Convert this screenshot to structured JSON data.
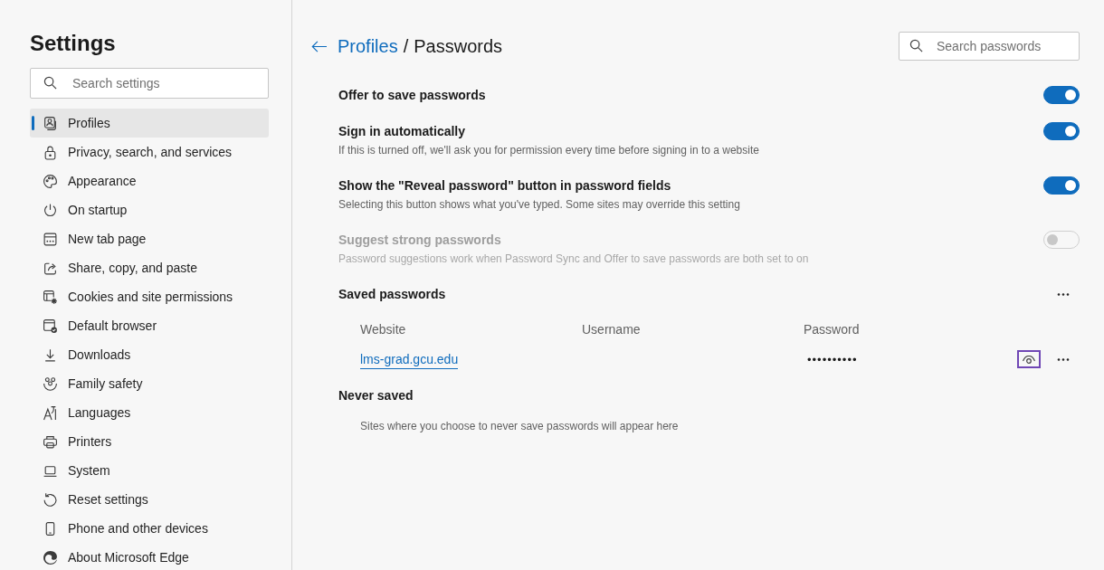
{
  "sidebar": {
    "title": "Settings",
    "search": {
      "placeholder": "Search settings"
    },
    "items": [
      {
        "label": "Profiles",
        "kind": "profiles",
        "selected": true
      },
      {
        "label": "Privacy, search, and services",
        "kind": "privacy",
        "selected": false
      },
      {
        "label": "Appearance",
        "kind": "appearance",
        "selected": false
      },
      {
        "label": "On startup",
        "kind": "startup",
        "selected": false
      },
      {
        "label": "New tab page",
        "kind": "newtab",
        "selected": false
      },
      {
        "label": "Share, copy, and paste",
        "kind": "share",
        "selected": false
      },
      {
        "label": "Cookies and site permissions",
        "kind": "cookies",
        "selected": false
      },
      {
        "label": "Default browser",
        "kind": "default",
        "selected": false
      },
      {
        "label": "Downloads",
        "kind": "downloads",
        "selected": false
      },
      {
        "label": "Family safety",
        "kind": "family",
        "selected": false
      },
      {
        "label": "Languages",
        "kind": "languages",
        "selected": false
      },
      {
        "label": "Printers",
        "kind": "printers",
        "selected": false
      },
      {
        "label": "System",
        "kind": "system",
        "selected": false
      },
      {
        "label": "Reset settings",
        "kind": "reset",
        "selected": false
      },
      {
        "label": "Phone and other devices",
        "kind": "phone",
        "selected": false
      },
      {
        "label": "About Microsoft Edge",
        "kind": "about",
        "selected": false
      }
    ]
  },
  "header": {
    "breadcrumb": [
      {
        "label": "Profiles",
        "kind": "link"
      },
      {
        "label": "/",
        "kind": "separator"
      },
      {
        "label": "Passwords",
        "kind": "current"
      }
    ],
    "search": {
      "placeholder": "Search passwords"
    }
  },
  "settings": [
    {
      "title": "Offer to save passwords",
      "on": true,
      "disabled": false
    },
    {
      "title": "Sign in automatically",
      "description": "If this is turned off, we'll ask you for permission every time before signing in to a website",
      "on": true,
      "disabled": false
    },
    {
      "title": "Show the \"Reveal password\" button in password fields",
      "description": "Selecting this button shows what you've typed. Some sites may override this setting",
      "on": true,
      "disabled": false
    },
    {
      "title": "Suggest strong passwords",
      "description": "Password suggestions work when Password Sync and Offer to save passwords are both set to on",
      "on": false,
      "disabled": true
    }
  ],
  "saved_passwords": {
    "title": "Saved passwords",
    "columns": [
      "Website",
      "Username",
      "Password"
    ],
    "rows": [
      {
        "website": "lms-grad.gcu.edu",
        "password": "••••••••••",
        "reveal_focused": true
      }
    ]
  },
  "never_saved": {
    "title": "Never saved",
    "message": "Sites where you choose to never save passwords will appear here"
  }
}
